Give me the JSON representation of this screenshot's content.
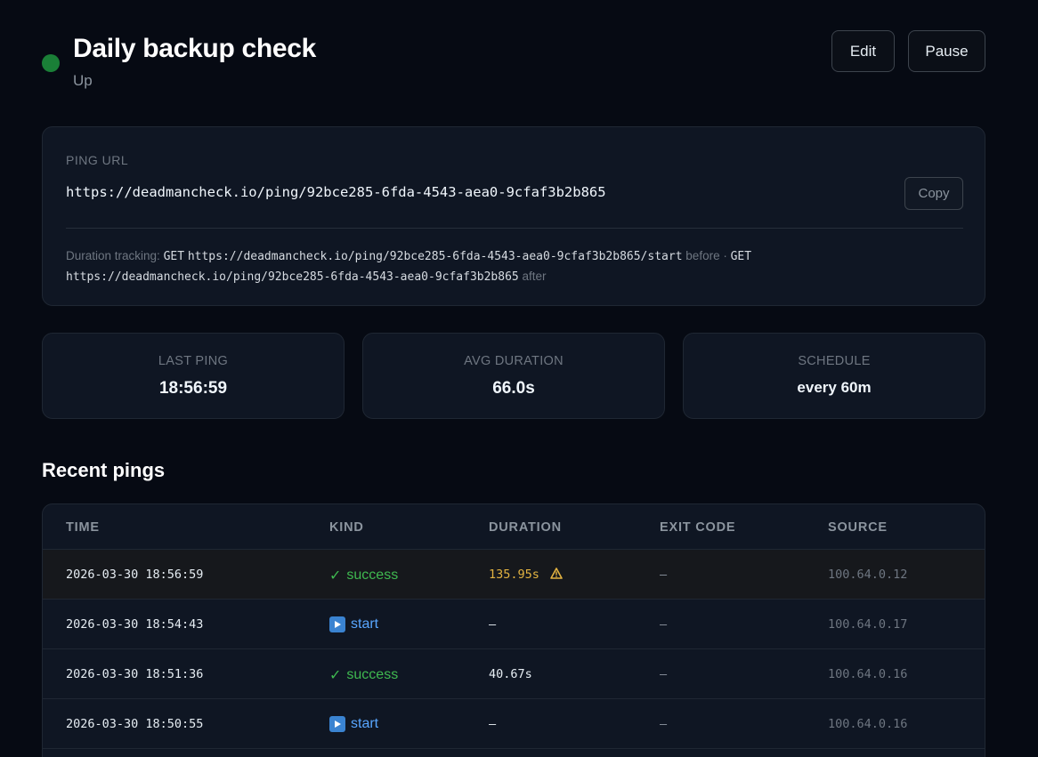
{
  "header": {
    "title": "Daily backup check",
    "status": "Up",
    "status_color": "#1a7f37",
    "edit_label": "Edit",
    "pause_label": "Pause"
  },
  "ping": {
    "label": "PING URL",
    "url": "https://deadmancheck.io/ping/92bce285-6fda-4543-aea0-9cfaf3b2b865",
    "copy_label": "Copy",
    "duration_prefix": "Duration tracking:",
    "get1": "GET",
    "start_url": "https://deadmancheck.io/ping/92bce285-6fda-4543-aea0-9cfaf3b2b865/start",
    "before": "before ·",
    "get2": "GET",
    "end_url": "https://deadmancheck.io/ping/92bce285-6fda-4543-aea0-9cfaf3b2b865",
    "after": "after"
  },
  "stats": [
    {
      "label": "LAST PING",
      "value": "18:56:59"
    },
    {
      "label": "AVG DURATION",
      "value": "66.0s"
    },
    {
      "label": "SCHEDULE",
      "value": "every 60m"
    }
  ],
  "recent": {
    "title": "Recent pings",
    "columns": [
      "TIME",
      "KIND",
      "DURATION",
      "EXIT CODE",
      "SOURCE"
    ],
    "rows": [
      {
        "time": "2026-03-30 18:56:59",
        "kind": "success",
        "kind_icon": "check-icon",
        "duration": "135.95s",
        "duration_warning": true,
        "exit": "—",
        "source": "100.64.0.12"
      },
      {
        "time": "2026-03-30 18:54:43",
        "kind": "start",
        "kind_icon": "play-icon",
        "duration": "—",
        "duration_warning": false,
        "exit": "—",
        "source": "100.64.0.17"
      },
      {
        "time": "2026-03-30 18:51:36",
        "kind": "success",
        "kind_icon": "check-icon",
        "duration": "40.67s",
        "duration_warning": false,
        "exit": "—",
        "source": "100.64.0.16"
      },
      {
        "time": "2026-03-30 18:50:55",
        "kind": "start",
        "kind_icon": "play-icon",
        "duration": "—",
        "duration_warning": false,
        "exit": "—",
        "source": "100.64.0.16"
      }
    ]
  },
  "colors": {
    "success": "#3fb950",
    "start": "#58a6ff",
    "warning": "#e3b341"
  }
}
